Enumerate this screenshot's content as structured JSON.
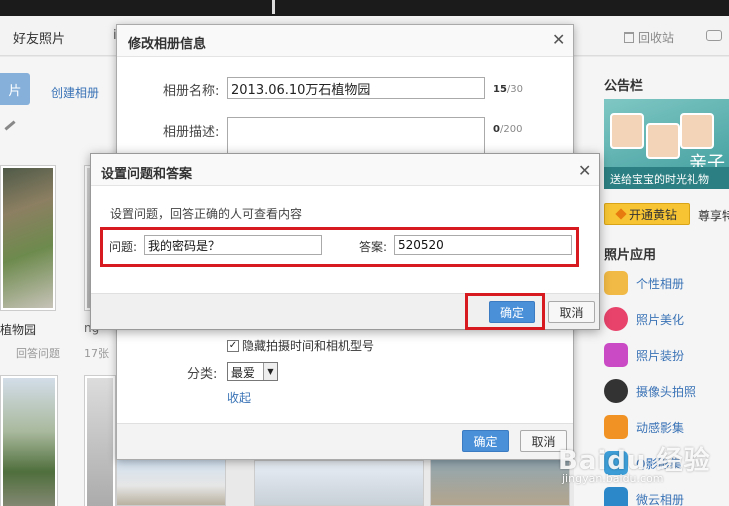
{
  "nav": {
    "friends_photos": "好友照片",
    "more_dot": "i",
    "recycle_bin": "回收站"
  },
  "left": {
    "upload_label": "片",
    "create_album": "创建相册",
    "albums": [
      {
        "name": "植物园",
        "meta": "回答问题"
      },
      {
        "name": "ng",
        "meta": "17张"
      }
    ]
  },
  "right": {
    "notice_title": "公告栏",
    "banner_deco": "亲子",
    "banner_caption": "送给宝宝的时光礼物",
    "vip_button": "开通黄钻",
    "vip_more": "尊享特",
    "apps_title": "照片应用",
    "apps": [
      {
        "label": "个性相册",
        "icon": "album-icon"
      },
      {
        "label": "照片美化",
        "icon": "beauty-icon"
      },
      {
        "label": "照片装扮",
        "icon": "decor-icon"
      },
      {
        "label": "摄像头拍照",
        "icon": "camera-icon"
      },
      {
        "label": "动感影集",
        "icon": "dynamic-album-icon"
      },
      {
        "label": "Q影影集",
        "icon": "qq-album-icon"
      },
      {
        "label": "微云相册",
        "icon": "weiyun-icon"
      }
    ]
  },
  "edit_dialog": {
    "title": "修改相册信息",
    "name_label": "相册名称:",
    "name_value": "2013.06.10万石植物园",
    "name_count": "15",
    "name_max": "/30",
    "desc_label": "相册描述:",
    "desc_count": "0",
    "desc_max": "/200",
    "hide_exif_label": "隐藏拍摄时间和相机型号",
    "category_label": "分类:",
    "category_value": "最爱",
    "collapse": "收起",
    "ok": "确定",
    "cancel": "取消"
  },
  "qa_dialog": {
    "title": "设置问题和答案",
    "hint": "设置问题，回答正确的人可查看内容",
    "question_label": "问题:",
    "question_value": "我的密码是？",
    "answer_label": "答案:",
    "answer_value": "520520",
    "ok": "确定",
    "cancel": "取消"
  },
  "watermark": {
    "brand": "Baidu 经验",
    "url": "jingyan.baidu.com"
  },
  "colors": {
    "primary_button": "#4a90d9",
    "highlight_box": "#d71920",
    "link": "#3a73b6"
  }
}
